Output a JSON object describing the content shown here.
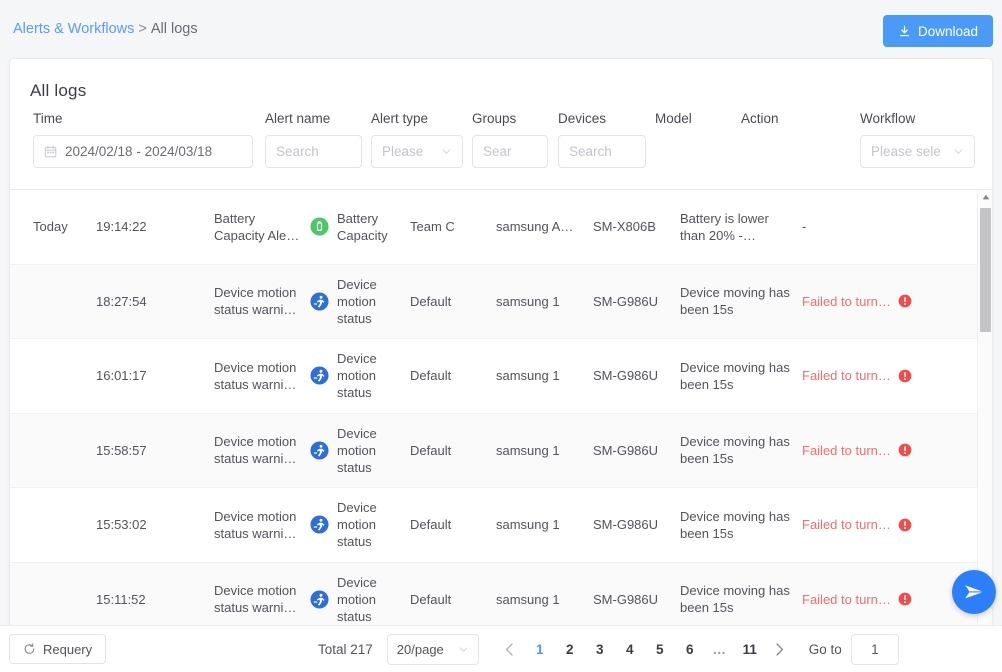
{
  "breadcrumb": {
    "parent": "Alerts & Workflows",
    "separator": ">",
    "current": "All logs"
  },
  "toolbar": {
    "download_label": "Download",
    "download_icon": "download-icon",
    "download_color": "#4a9bf7"
  },
  "card": {
    "title": "All logs"
  },
  "filters": [
    {
      "label": "Time",
      "value": "2024/02/18 - 2024/03/18",
      "placeholder": "",
      "type": "daterange",
      "icon": "calendar-icon"
    },
    {
      "label": "Alert name",
      "value": "",
      "placeholder": "Search",
      "type": "text"
    },
    {
      "label": "Alert type",
      "value": "",
      "placeholder": "Please",
      "type": "select"
    },
    {
      "label": "Groups",
      "value": "",
      "placeholder": "Sear",
      "type": "text"
    },
    {
      "label": "Devices",
      "value": "",
      "placeholder": "Search",
      "type": "text"
    },
    {
      "label": "Model",
      "value": "",
      "placeholder": "",
      "type": "none"
    },
    {
      "label": "Action",
      "value": "",
      "placeholder": "",
      "type": "none"
    },
    {
      "label": "Workflow",
      "value": "",
      "placeholder": "Please sele",
      "type": "select"
    }
  ],
  "table": {
    "columns": [
      "Time",
      "Alert name",
      "Alert type",
      "Groups",
      "Devices",
      "Model",
      "Action",
      "Workflow"
    ],
    "rows": [
      {
        "day": "Today",
        "time": "19:14:22",
        "alert_name": "Battery Capacity Ale…",
        "alert_type": "Battery Capacity",
        "alert_type_icon": "battery-icon",
        "alert_type_color": "#4cc76a",
        "group": "Team C",
        "device": "samsung A…",
        "model": "SM-X806B",
        "action": "Battery is lower than 20% -…",
        "workflow": "-",
        "workflow_failed": false
      },
      {
        "day": "",
        "time": "18:27:54",
        "alert_name": "Device motion status warni…",
        "alert_type": "Device motion status",
        "alert_type_icon": "running-person-icon",
        "alert_type_color": "#2d6fd8",
        "group": "Default",
        "device": "samsung 1",
        "model": "SM-G986U",
        "action": "Device moving has been 15s",
        "workflow": "Failed to turn…",
        "workflow_failed": true
      },
      {
        "day": "",
        "time": "16:01:17",
        "alert_name": "Device motion status warni…",
        "alert_type": "Device motion status",
        "alert_type_icon": "running-person-icon",
        "alert_type_color": "#2d6fd8",
        "group": "Default",
        "device": "samsung 1",
        "model": "SM-G986U",
        "action": "Device moving has been 15s",
        "workflow": "Failed to turn…",
        "workflow_failed": true
      },
      {
        "day": "",
        "time": "15:58:57",
        "alert_name": "Device motion status warni…",
        "alert_type": "Device motion status",
        "alert_type_icon": "running-person-icon",
        "alert_type_color": "#2d6fd8",
        "group": "Default",
        "device": "samsung 1",
        "model": "SM-G986U",
        "action": "Device moving has been 15s",
        "workflow": "Failed to turn…",
        "workflow_failed": true
      },
      {
        "day": "",
        "time": "15:53:02",
        "alert_name": "Device motion status warni…",
        "alert_type": "Device motion status",
        "alert_type_icon": "running-person-icon",
        "alert_type_color": "#2d6fd8",
        "group": "Default",
        "device": "samsung 1",
        "model": "SM-G986U",
        "action": "Device moving has been 15s",
        "workflow": "Failed to turn…",
        "workflow_failed": true
      },
      {
        "day": "",
        "time": "15:11:52",
        "alert_name": "Device motion status warni…",
        "alert_type": "Device motion status",
        "alert_type_icon": "running-person-icon",
        "alert_type_color": "#2d6fd8",
        "group": "Default",
        "device": "samsung 1",
        "model": "SM-G986U",
        "action": "Device moving has been 15s",
        "workflow": "Failed to turn…",
        "workflow_failed": true
      }
    ]
  },
  "footer": {
    "requery_label": "Requery",
    "requery_icon": "refresh-icon",
    "total_label": "Total 217",
    "page_size": "20/page",
    "prev_icon": "chevron-left-icon",
    "next_icon": "chevron-right-icon",
    "pages": [
      "1",
      "2",
      "3",
      "4",
      "5",
      "6",
      "…",
      "11"
    ],
    "active_page": "1",
    "goto_label": "Go to",
    "goto_value": "1"
  },
  "fab": {
    "icon": "send-plane-icon",
    "color": "#2d7ff9"
  },
  "colors": {
    "accent": "#4a9bf7",
    "link": "#5b9cf8",
    "error": "#f56c6c",
    "row_alt": "#fafafa"
  }
}
